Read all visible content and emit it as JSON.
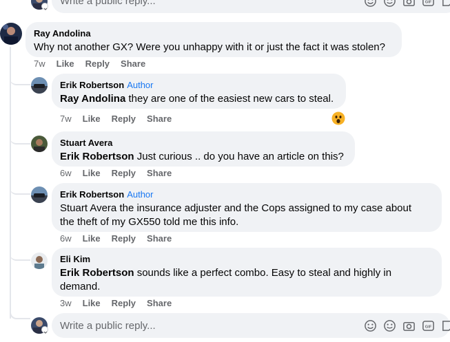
{
  "top_reply": {
    "placeholder": "Write a public reply..."
  },
  "main_comment": {
    "author": "Ray Andolina",
    "text": "Why not another GX? Were you unhappy with it or just the fact it was stolen?",
    "time": "7w",
    "actions": [
      "Like",
      "Reply",
      "Share"
    ]
  },
  "replies": [
    {
      "author": "Erik Robertson",
      "badge": "Author",
      "mention": "Ray Andolina",
      "text": " they are one of the easiest new cars to steal.",
      "time": "7w",
      "actions": [
        "Like",
        "Reply",
        "Share"
      ],
      "reaction": "wow"
    },
    {
      "author": "Stuart Avera",
      "mention": "Erik Robertson",
      "text": " Just curious .. do you have an article on this?",
      "time": "6w",
      "actions": [
        "Like",
        "Reply",
        "Share"
      ]
    },
    {
      "author": "Erik Robertson",
      "badge": "Author",
      "text_line1": "Stuart Avera the insurance adjuster and the Cops assigned to my case about",
      "text_line2": "the theft of my GX550 told me this info.",
      "time": "6w",
      "actions": [
        "Like",
        "Reply",
        "Share"
      ]
    },
    {
      "author": "Eli Kim",
      "mention": "Erik Robertson",
      "text_line1": " sounds like a perfect combo. Easy to steal and highly in",
      "text_line2": "demand.",
      "time": "3w",
      "actions": [
        "Like",
        "Reply",
        "Share"
      ]
    }
  ],
  "bottom_reply": {
    "placeholder": "Write a public reply..."
  },
  "icons": [
    "avatar-icon",
    "emoji-icon",
    "camera-icon",
    "gif-icon",
    "sticker-icon",
    "wow-reaction-icon",
    "chevron-down-icon"
  ],
  "colors": {
    "bubble": "#f0f2f5",
    "author_badge": "#1877f2",
    "meta_text": "#65676b",
    "thread_line": "#e4e6eb"
  }
}
